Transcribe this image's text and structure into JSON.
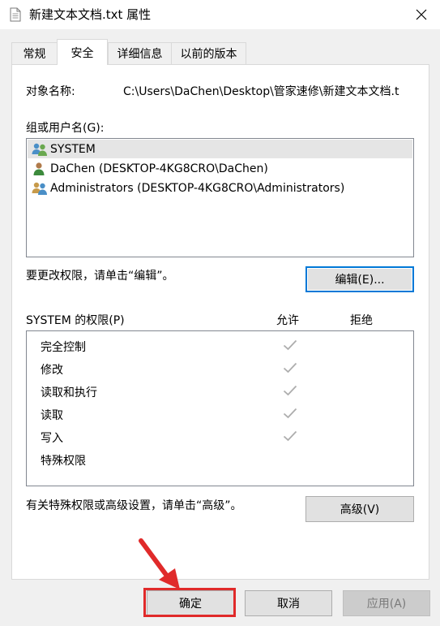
{
  "window": {
    "title": "新建文本文档.txt 属性",
    "icon": "text-file-icon",
    "close_icon": "close-icon"
  },
  "tabs": [
    {
      "label": "常规",
      "active": false
    },
    {
      "label": "安全",
      "active": true
    },
    {
      "label": "详细信息",
      "active": false
    },
    {
      "label": "以前的版本",
      "active": false
    }
  ],
  "security": {
    "object_name_label": "对象名称:",
    "object_name_value": "C:\\Users\\DaChen\\Desktop\\管家速修\\新建文本文档.t",
    "group_label": "组或用户名(G):",
    "users": [
      {
        "name": "SYSTEM",
        "icon": "group-icon",
        "selected": true
      },
      {
        "name": "DaChen (DESKTOP-4KG8CRO\\DaChen)",
        "icon": "user-icon",
        "selected": false
      },
      {
        "name": "Administrators (DESKTOP-4KG8CRO\\Administrators)",
        "icon": "group-icon",
        "selected": false
      }
    ],
    "change_perm_text": "要更改权限，请单击“编辑”。",
    "edit_button": "编辑(E)...",
    "perm_header": "SYSTEM 的权限(P)",
    "allow_header": "允许",
    "deny_header": "拒绝",
    "permissions": [
      {
        "name": "完全控制",
        "allow": true,
        "deny": false
      },
      {
        "name": "修改",
        "allow": true,
        "deny": false
      },
      {
        "name": "读取和执行",
        "allow": true,
        "deny": false
      },
      {
        "name": "读取",
        "allow": true,
        "deny": false
      },
      {
        "name": "写入",
        "allow": true,
        "deny": false
      },
      {
        "name": "特殊权限",
        "allow": false,
        "deny": false
      }
    ],
    "advanced_text": "有关特殊权限或高级设置，请单击“高级”。",
    "advanced_button": "高级(V)"
  },
  "footer": {
    "ok": "确定",
    "cancel": "取消",
    "apply": "应用(A)"
  },
  "annotation": {
    "highlight_color": "#e02a2a"
  }
}
